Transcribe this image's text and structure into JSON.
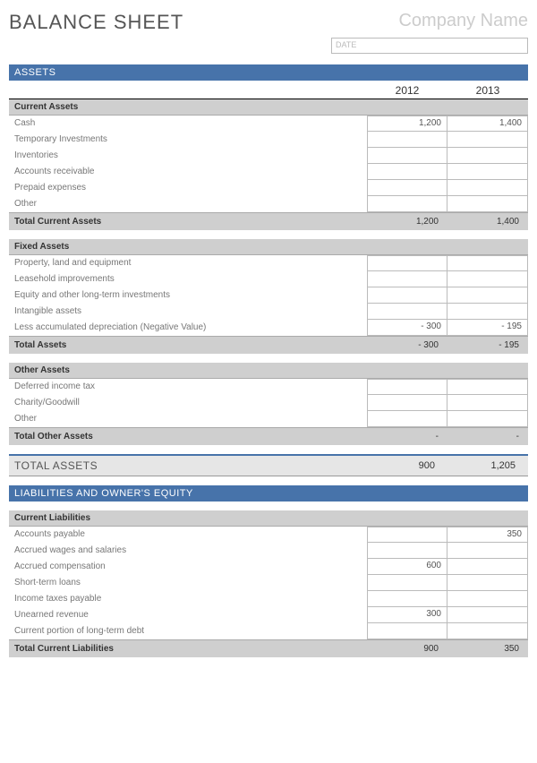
{
  "header": {
    "title": "BALANCE SHEET",
    "company": "Company Name",
    "date_placeholder": "DATE"
  },
  "years": {
    "y1": "2012",
    "y2": "2013"
  },
  "sections": {
    "assets_bar": "ASSETS",
    "liab_bar": "LIABILITIES AND OWNER'S EQUITY"
  },
  "current_assets": {
    "heading": "Current Assets",
    "rows": [
      {
        "label": "Cash",
        "v1": "1,200",
        "v2": "1,400"
      },
      {
        "label": "Temporary Investments",
        "v1": "",
        "v2": ""
      },
      {
        "label": "Inventories",
        "v1": "",
        "v2": ""
      },
      {
        "label": "Accounts receivable",
        "v1": "",
        "v2": ""
      },
      {
        "label": "Prepaid expenses",
        "v1": "",
        "v2": ""
      },
      {
        "label": "Other",
        "v1": "",
        "v2": ""
      }
    ],
    "total_label": "Total Current Assets",
    "total_v1": "1,200",
    "total_v2": "1,400"
  },
  "fixed_assets": {
    "heading": "Fixed Assets",
    "rows": [
      {
        "label": "Property, land and equipment",
        "v1": "",
        "v2": ""
      },
      {
        "label": "Leasehold improvements",
        "v1": "",
        "v2": ""
      },
      {
        "label": "Equity and other long-term investments",
        "v1": "",
        "v2": ""
      },
      {
        "label": "Intangible assets",
        "v1": "",
        "v2": ""
      },
      {
        "label": "Less accumulated depreciation (Negative Value)",
        "v1": "- 300",
        "v2": "- 195"
      }
    ],
    "total_label": "Total Assets",
    "total_v1": "- 300",
    "total_v2": "- 195"
  },
  "other_assets": {
    "heading": "Other Assets",
    "rows": [
      {
        "label": "Deferred income tax",
        "v1": "",
        "v2": ""
      },
      {
        "label": "Charity/Goodwill",
        "v1": "",
        "v2": ""
      },
      {
        "label": "Other",
        "v1": "",
        "v2": ""
      }
    ],
    "total_label": "Total Other Assets",
    "total_v1": "-",
    "total_v2": "-"
  },
  "grand_assets": {
    "label": "TOTAL ASSETS",
    "v1": "900",
    "v2": "1,205"
  },
  "current_liabilities": {
    "heading": "Current Liabilities",
    "rows": [
      {
        "label": "Accounts payable",
        "v1": "",
        "v2": "350"
      },
      {
        "label": "Accrued wages and salaries",
        "v1": "",
        "v2": ""
      },
      {
        "label": "Accrued compensation",
        "v1": "600",
        "v2": ""
      },
      {
        "label": "Short-term loans",
        "v1": "",
        "v2": ""
      },
      {
        "label": "Income taxes payable",
        "v1": "",
        "v2": ""
      },
      {
        "label": "Unearned revenue",
        "v1": "300",
        "v2": ""
      },
      {
        "label": "Current portion of long-term debt",
        "v1": "",
        "v2": ""
      }
    ],
    "total_label": "Total Current Liabilities",
    "total_v1": "900",
    "total_v2": "350"
  }
}
